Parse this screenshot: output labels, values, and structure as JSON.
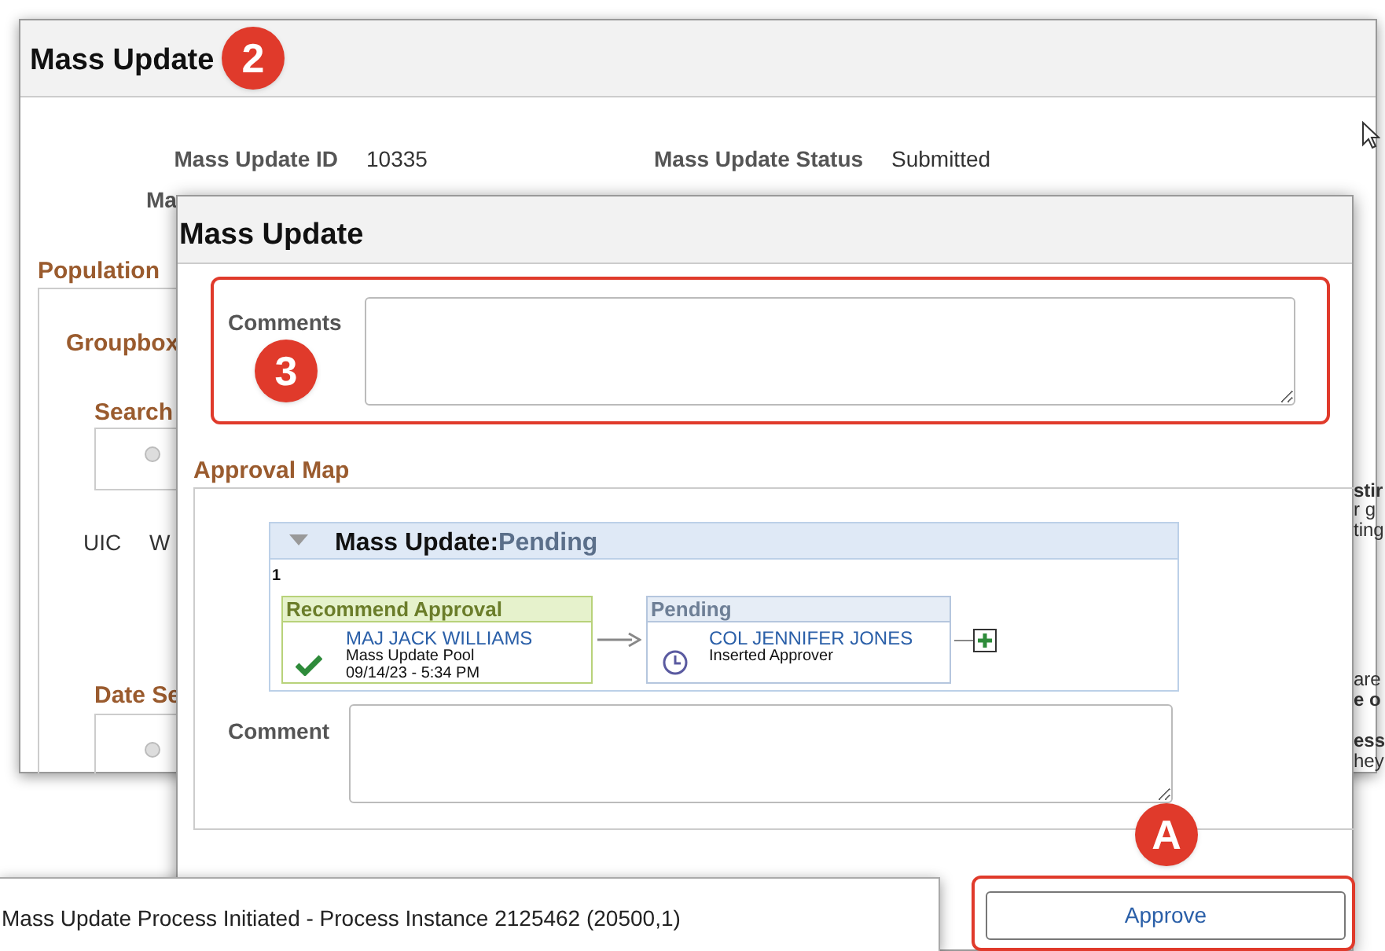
{
  "back_window": {
    "title": "Mass Update",
    "badge": "2",
    "fields": [
      {
        "label": "Mass Update ID",
        "value": "10335"
      },
      {
        "label": "Mass Update Status",
        "value": "Submitted"
      }
    ],
    "partial_label": "Ma",
    "section": "Population",
    "groupbox": "Groupbox",
    "search": "Search",
    "uic": "UIC",
    "we": "W",
    "radios": [
      {
        "disabled": true
      },
      {
        "disabled": true
      }
    ],
    "date": "Date Se",
    "edge_texts": [
      {
        "text": "stir",
        "bold": true
      },
      {
        "text": "r g",
        "bold": false
      },
      {
        "text": "ting",
        "bold": false
      },
      {
        "text": "are",
        "bold": false
      },
      {
        "text": "e o",
        "bold": true
      },
      {
        "text": "ess",
        "bold": true
      },
      {
        "text": "hey",
        "bold": false
      }
    ]
  },
  "dialog": {
    "title": "Mass Update",
    "comments_label": "Comments",
    "badge_comments": "3",
    "approval_map_label": "Approval Map",
    "map": {
      "title": "Mass Update:",
      "status": "Pending",
      "expanded": true,
      "path": "1",
      "steps": [
        {
          "header": "Recommend Approval",
          "kind": "approved",
          "name": "MAJ JACK WILLIAMS",
          "role": "Mass Update Pool",
          "date": "09/14/23 - 5:34 PM"
        },
        {
          "header": "Pending",
          "kind": "pending",
          "name": "COL JENNIFER JONES",
          "role": "Inserted Approver"
        }
      ]
    },
    "comment_label": "Comment",
    "badge_action": "A",
    "approve_button": "Approve"
  },
  "message": "Mass Update Process Initiated - Process Instance 2125462 (20500,1)"
}
